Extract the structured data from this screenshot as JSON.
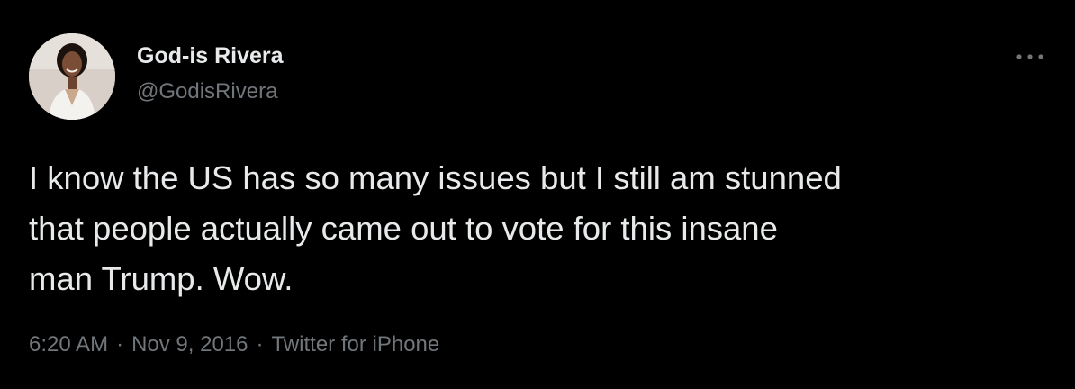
{
  "author": {
    "display_name": "God-is Rivera",
    "handle": "@GodisRivera",
    "avatar_icon": "profile-photo"
  },
  "more_menu_icon": "ellipsis-icon",
  "tweet": {
    "text_lines": [
      "I know the US has so many issues but I still am stunned",
      "that people actually came out to vote for this insane",
      "man Trump. Wow."
    ]
  },
  "meta": {
    "time": "6:20 AM",
    "separator": "·",
    "date": "Nov 9, 2016",
    "source": "Twitter for iPhone"
  },
  "colors": {
    "background": "#000000",
    "primary_text": "#e7e9ea",
    "secondary_text": "#71767b"
  }
}
